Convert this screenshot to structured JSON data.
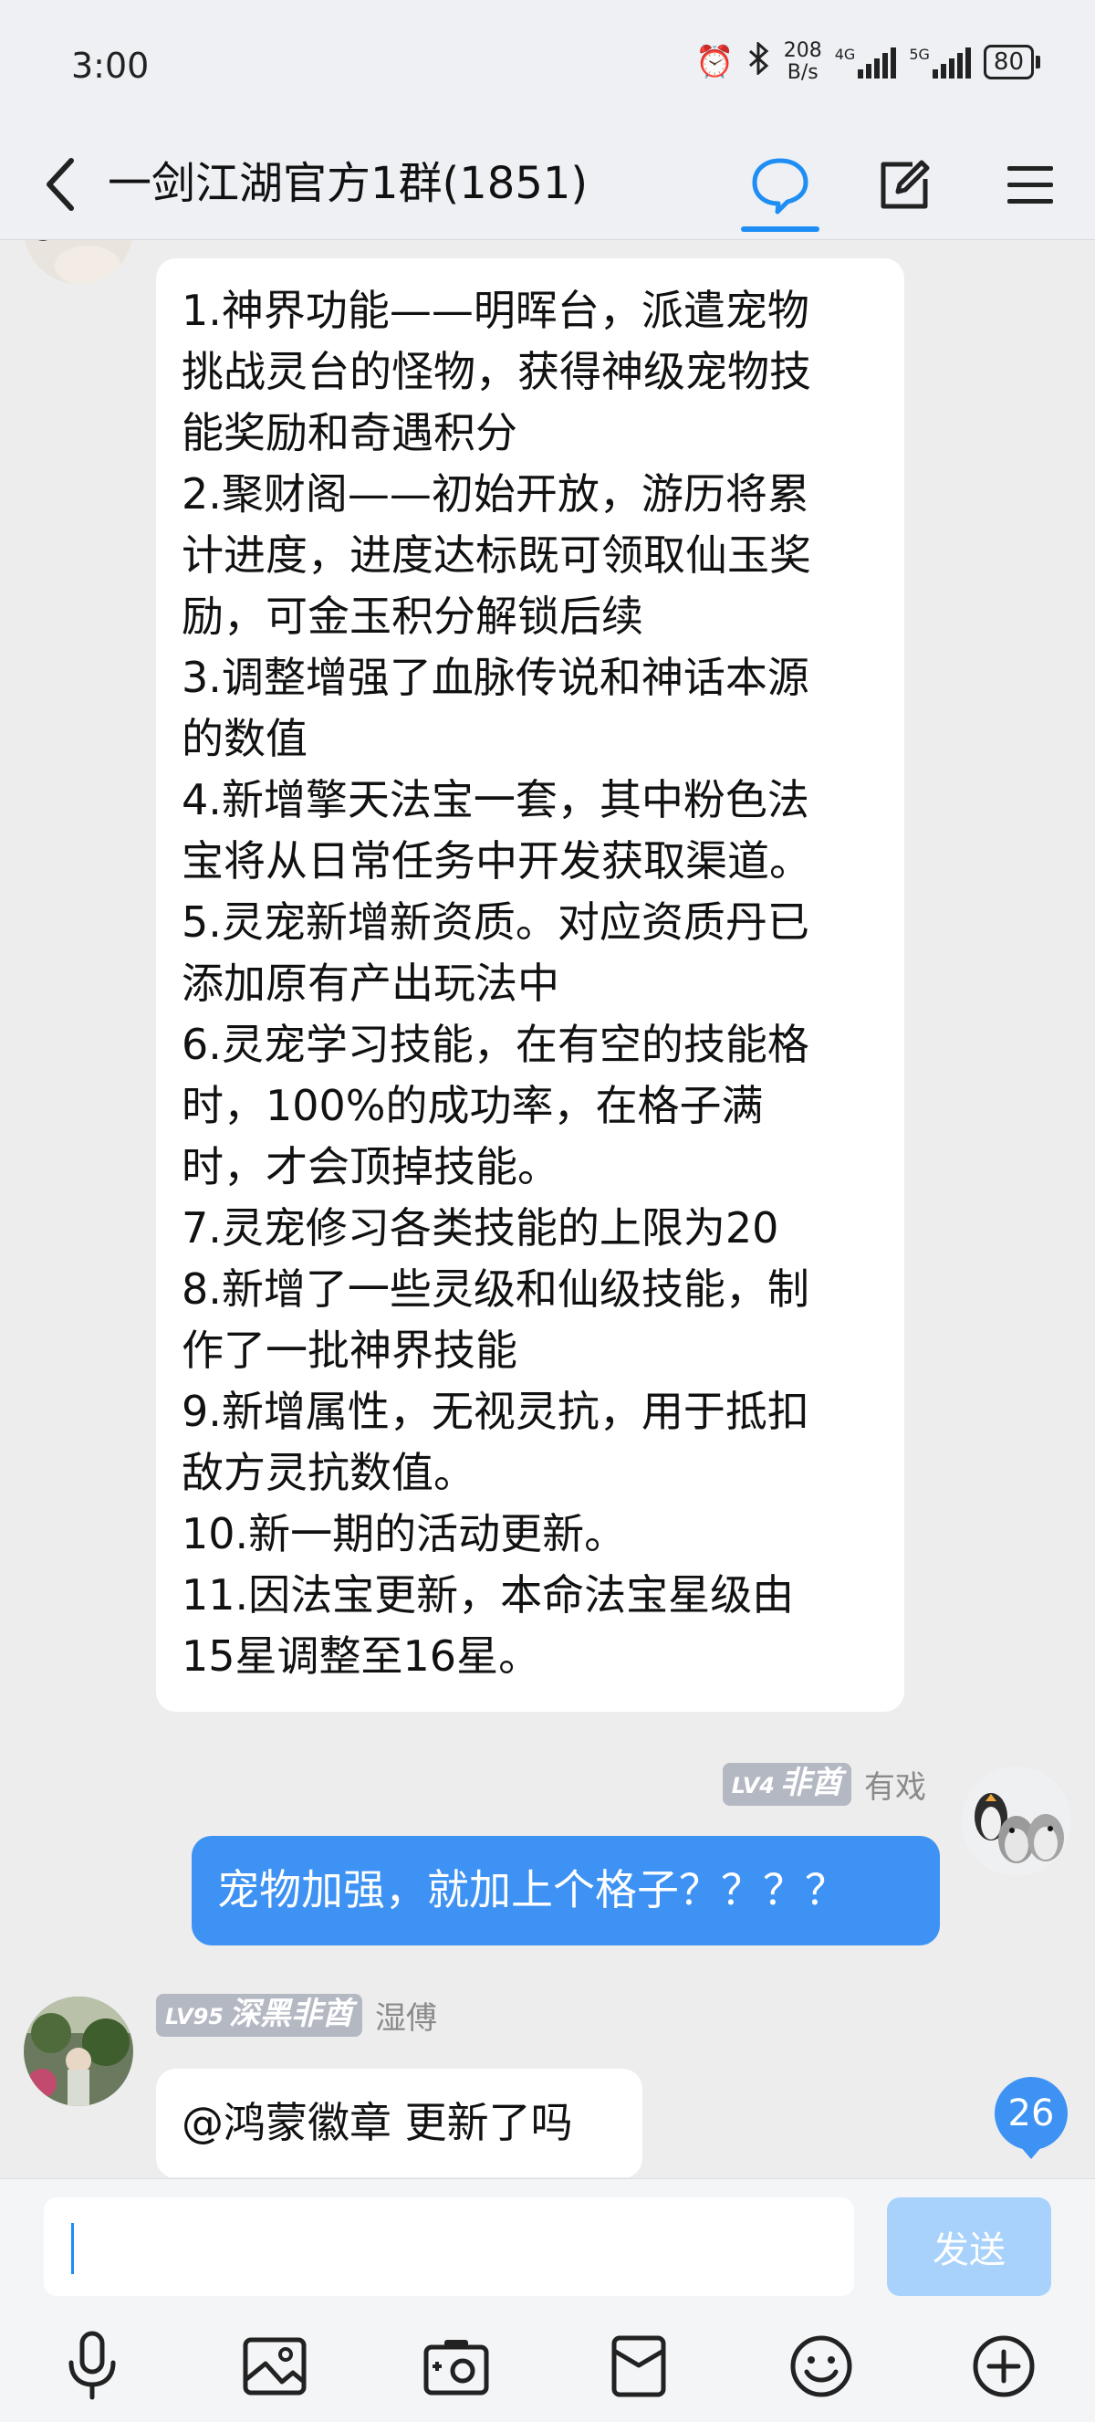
{
  "status": {
    "time": "3:00",
    "net_speed_value": "208",
    "net_speed_unit": "B/s",
    "sig1": "4G",
    "sig2": "5G",
    "battery": "80"
  },
  "header": {
    "title": "一剑江湖官方1群(1851)"
  },
  "messages": {
    "m1": {
      "text": "1.神界功能——明晖台，派遣宠物\n挑战灵台的怪物，获得神级宠物技\n能奖励和奇遇积分\n2.聚财阁——初始开放，游历将累\n计进度，进度达标既可领取仙玉奖\n励，可金玉积分解锁后续\n3.调整增强了血脉传说和神话本源\n的数值\n4.新增擎天法宝一套，其中粉色法\n宝将从日常任务中开发获取渠道。\n5.灵宠新增新资质。对应资质丹已\n添加原有产出玩法中\n6.灵宠学习技能，在有空的技能格\n时，100%的成功率，在格子满\n时，才会顶掉技能。\n7.灵宠修习各类技能的上限为20\n8.新增了一些灵级和仙级技能，制\n作了一批神界技能\n9.新增属性，无视灵抗，用于抵扣\n敌方灵抗数值。\n10.新一期的活动更新。\n11.因法宝更新，本命法宝星级由\n15星调整至16星。"
    },
    "m2": {
      "level": "LV4",
      "title": "非酋",
      "nick": "有戏",
      "text": "宠物加强，就加上个格子？？？？"
    },
    "m3": {
      "level": "LV95",
      "title": "深黑非酋",
      "nick": "湿傅",
      "text": "@鸿蒙徽章  更新了吗"
    }
  },
  "unread_count": "26",
  "input": {
    "placeholder": "",
    "send_label": "发送"
  },
  "colors": {
    "accent": "#3d92f3",
    "badge_gray": "#b4b8c3",
    "send_disabled": "#a8d2fb"
  }
}
